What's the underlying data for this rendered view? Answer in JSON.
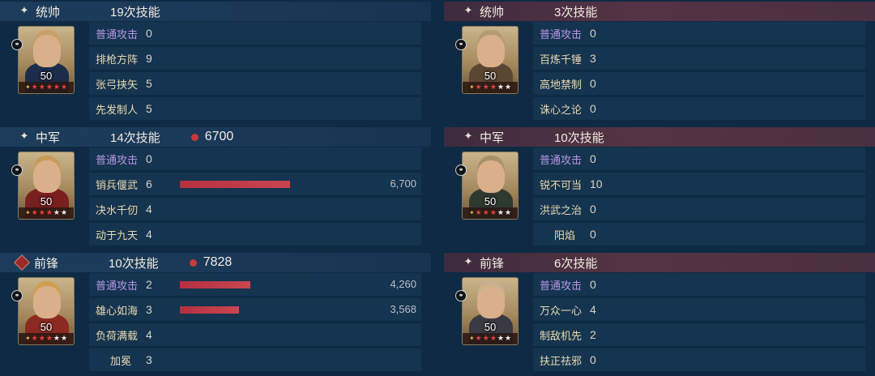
{
  "icons": {
    "header_mark": "✦",
    "side_badge": "⚭"
  },
  "left": [
    {
      "position": "统帅",
      "count": "19次技能",
      "damage_total": null,
      "level": "50",
      "stars": [
        "gold",
        "red",
        "red",
        "red",
        "red",
        "red"
      ],
      "skills": [
        {
          "name": "普通攻击",
          "times": "0",
          "type": "normal",
          "damage": null
        },
        {
          "name": "排枪方阵",
          "times": "9",
          "type": "skill",
          "damage": null
        },
        {
          "name": "张弓挟矢",
          "times": "5",
          "type": "skill",
          "damage": null
        },
        {
          "name": "先发制人",
          "times": "5",
          "type": "skill",
          "damage": null
        }
      ]
    },
    {
      "position": "中军",
      "count": "14次技能",
      "damage_total": "6700",
      "level": "50",
      "stars": [
        "gold",
        "red",
        "red",
        "red",
        "white",
        "white"
      ],
      "skills": [
        {
          "name": "普通攻击",
          "times": "0",
          "type": "normal",
          "damage": null
        },
        {
          "name": "销兵偃武",
          "times": "6",
          "type": "skill",
          "damage": "6,700",
          "share": 1.0
        },
        {
          "name": "决水千仞",
          "times": "4",
          "type": "skill",
          "damage": null
        },
        {
          "name": "动于九天",
          "times": "4",
          "type": "skill",
          "damage": null
        }
      ]
    },
    {
      "position": "前锋",
      "count": "10次技能",
      "damage_total": "7828",
      "level": "50",
      "stars": [
        "gold",
        "red",
        "red",
        "red",
        "white",
        "white"
      ],
      "skills": [
        {
          "name": "普通攻击",
          "times": "2",
          "type": "normal",
          "damage": "4,260",
          "share": 0.64
        },
        {
          "name": "雄心如海",
          "times": "3",
          "type": "skill",
          "damage": "3,568",
          "share": 0.54
        },
        {
          "name": "负荷满载",
          "times": "4",
          "type": "skill",
          "damage": null
        },
        {
          "name": "加冕",
          "times": "3",
          "type": "skill",
          "damage": null,
          "indent": true
        }
      ]
    }
  ],
  "right": [
    {
      "position": "统帅",
      "count": "3次技能",
      "damage_total": null,
      "level": "50",
      "stars": [
        "gold",
        "red",
        "red",
        "red",
        "white",
        "white"
      ],
      "skills": [
        {
          "name": "普通攻击",
          "times": "0",
          "type": "normal",
          "damage": null
        },
        {
          "name": "百炼千锤",
          "times": "3",
          "type": "skill",
          "damage": null
        },
        {
          "name": "高地禁制",
          "times": "0",
          "type": "skill",
          "damage": null
        },
        {
          "name": "诛心之论",
          "times": "0",
          "type": "skill",
          "damage": null
        }
      ]
    },
    {
      "position": "中军",
      "count": "10次技能",
      "damage_total": null,
      "level": "50",
      "stars": [
        "gold",
        "red",
        "red",
        "red",
        "white",
        "white"
      ],
      "skills": [
        {
          "name": "普通攻击",
          "times": "0",
          "type": "normal",
          "damage": null
        },
        {
          "name": "锐不可当",
          "times": "10",
          "type": "skill",
          "damage": null
        },
        {
          "name": "洪武之治",
          "times": "0",
          "type": "skill",
          "damage": null
        },
        {
          "name": "阳焰",
          "times": "0",
          "type": "skill",
          "damage": null,
          "indent": true
        }
      ]
    },
    {
      "position": "前锋",
      "count": "6次技能",
      "damage_total": null,
      "level": "50",
      "stars": [
        "gold",
        "red",
        "red",
        "red",
        "white",
        "white"
      ],
      "skills": [
        {
          "name": "普通攻击",
          "times": "0",
          "type": "normal",
          "damage": null
        },
        {
          "name": "万众一心",
          "times": "4",
          "type": "skill",
          "damage": null
        },
        {
          "name": "制敌机先",
          "times": "2",
          "type": "skill",
          "damage": null
        },
        {
          "name": "扶正祛邪",
          "times": "0",
          "type": "skill",
          "damage": null
        }
      ]
    }
  ]
}
